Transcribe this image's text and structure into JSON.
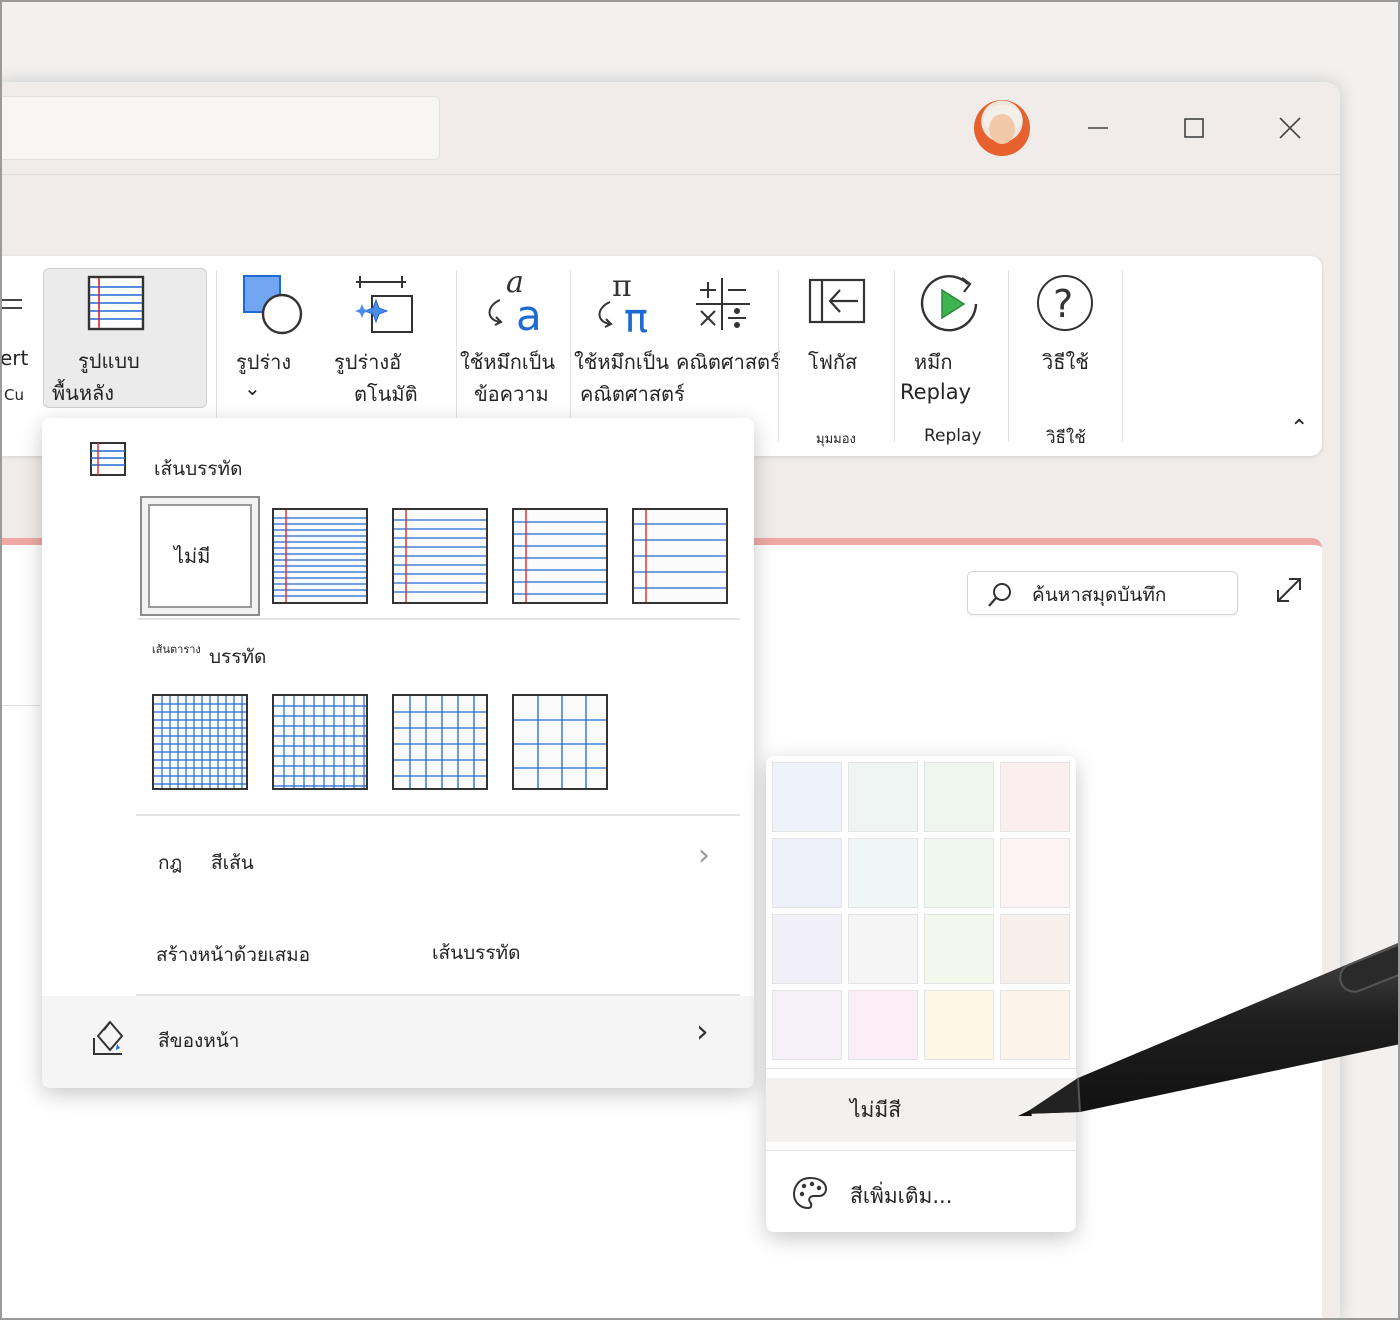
{
  "window": {
    "controls": {
      "minimize_icon": "minimize-icon",
      "maximize_icon": "maximize-icon",
      "close_icon": "close-icon"
    }
  },
  "ribbon": {
    "partial_left_label": "ert",
    "partial_left_small": "Cu",
    "background_style": {
      "line1": "รูปแบบ",
      "line2": "พื้นหลัง"
    },
    "shapes": {
      "label": "รูปร่าง",
      "chevron": "⌄"
    },
    "auto_shapes": {
      "line1": "รูปร่างอั",
      "line2": "ตโนมัติ"
    },
    "ink_to_text": {
      "line1": "ใช้หมึกเป็น",
      "line2": "ข้อความ"
    },
    "ink_to_math": {
      "line1": "ใช้หมึกเป็น",
      "line2": "คณิตศาสตร์"
    },
    "math": {
      "label": "คณิตศาสตร์"
    },
    "focus": {
      "label": "โฟกัส"
    },
    "view_group": "มุมมอง",
    "ink_replay": {
      "line1": "หมึก",
      "line2": "Replay"
    },
    "replay_group": "Replay",
    "help": {
      "label": "วิธีใช้"
    },
    "help_group": "วิธีใช้",
    "collapse_glyph": "⌃"
  },
  "page": {
    "search_placeholder": "ค้นหาสมุดบันทึก"
  },
  "menu": {
    "rule_lines_title": "เส้นบรรทัด",
    "none_label": "ไม่มี",
    "grid_title_small": "เส้นตาราง",
    "grid_title": "บรรทัด",
    "rule_color_a": "กฎ",
    "rule_color_b": "สีเส้น",
    "create_pages_a": "สร้างหน้าด้วยเสมอ",
    "create_pages_b": "เส้นบรรทัด",
    "page_color": "สีของหน้า",
    "arrow": "›"
  },
  "colors": {
    "swatches": [
      [
        "#edf2fb",
        "#eff5f3",
        "#eef6ee",
        "#fbeeef"
      ],
      [
        "#eef1fa",
        "#eef6f6",
        "#f0f7ef",
        "#fcf3f4"
      ],
      [
        "#f1f0f9",
        "#f5f5f6",
        "#f3f7ec",
        "#f7efe9"
      ],
      [
        "#f6f1f8",
        "#fbeef6",
        "#fdf8e6",
        "#fcf4ea"
      ]
    ],
    "no_color": "ไม่มีสี",
    "more_colors": "สีเพิ่มเติม..."
  }
}
